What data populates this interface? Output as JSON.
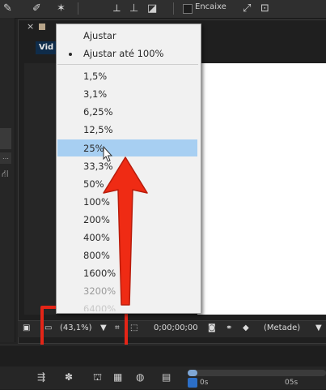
{
  "toolbar": {
    "encaixe_label": "Encaixe"
  },
  "panel": {
    "comp_tab_label": "Vid"
  },
  "zoom_menu": {
    "items": [
      {
        "label": "Ajustar"
      },
      {
        "label": "Ajustar até 100%",
        "selected": true
      },
      {
        "label": "1,5%"
      },
      {
        "label": "3,1%"
      },
      {
        "label": "6,25%"
      },
      {
        "label": "12,5%"
      },
      {
        "label": "25%",
        "highlighted": true
      },
      {
        "label": "33,3%"
      },
      {
        "label": "50%"
      },
      {
        "label": "100%"
      },
      {
        "label": "200%"
      },
      {
        "label": "400%"
      },
      {
        "label": "800%"
      },
      {
        "label": "1600%"
      },
      {
        "label": "3200%",
        "disabled": true
      },
      {
        "label": "6400%",
        "disabled": true
      }
    ]
  },
  "viewer_bar": {
    "zoom_value": "(43,1%)",
    "timecode": "0;00;00;00",
    "resolution": "(Metade)"
  },
  "timeline": {
    "start_label": "0s",
    "mark_label": "05s"
  },
  "colors": {
    "highlight": "#e42517",
    "menu_selection": "#a7cff2",
    "timeline_accent": "#2c6fc8"
  }
}
